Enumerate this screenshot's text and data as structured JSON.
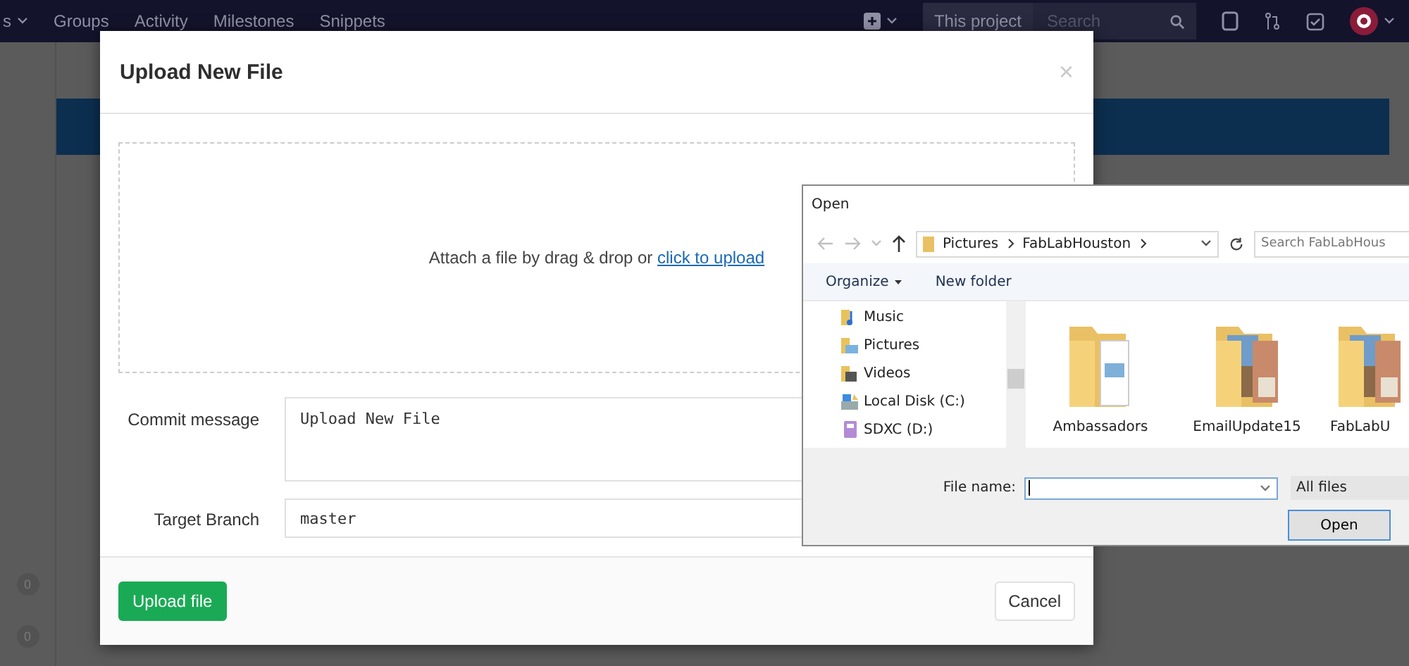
{
  "navbar": {
    "items": [
      {
        "label": "s",
        "dropdown": true
      },
      {
        "label": "Groups",
        "dropdown": false
      },
      {
        "label": "Activity",
        "dropdown": false
      },
      {
        "label": "Milestones",
        "dropdown": false
      },
      {
        "label": "Snippets",
        "dropdown": false
      }
    ],
    "scope": "This project",
    "search": {
      "placeholder": "Search"
    }
  },
  "sidebar": {
    "counts": [
      "0",
      "0"
    ]
  },
  "modal": {
    "title": "Upload New File",
    "close": "×",
    "dropzone": {
      "text": "Attach a file by drag & drop or ",
      "link": "click to upload"
    },
    "fields": [
      {
        "label": "Commit message",
        "kind": "textarea",
        "value": "Upload New File"
      },
      {
        "label": "Target Branch",
        "kind": "input",
        "value": "master"
      }
    ],
    "buttons": [
      {
        "label": "Upload file",
        "kind": "primary"
      },
      {
        "label": "Cancel",
        "kind": "default"
      }
    ]
  },
  "open_dialog": {
    "title": "Open",
    "path": [
      "Pictures",
      "FabLabHouston"
    ],
    "search": {
      "placeholder": "Search FabLabHous"
    },
    "toolbar": [
      {
        "label": "Organize",
        "dropdown": true
      },
      {
        "label": "New folder",
        "dropdown": false
      }
    ],
    "nav_items": [
      {
        "label": "Music",
        "kind": "music"
      },
      {
        "label": "Pictures",
        "kind": "pictures"
      },
      {
        "label": "Videos",
        "kind": "videos"
      },
      {
        "label": "Local Disk (C:)",
        "kind": "disk"
      },
      {
        "label": "SDXC (D:)",
        "kind": "sd"
      }
    ],
    "folders": [
      {
        "name": "Ambassadors",
        "kind": "documents"
      },
      {
        "name": "EmailUpdate15",
        "kind": "photos"
      },
      {
        "name": "FabLabU",
        "kind": "photos"
      }
    ],
    "file_name_label": "File name:",
    "file_type": "All files",
    "open_button": "Open"
  }
}
